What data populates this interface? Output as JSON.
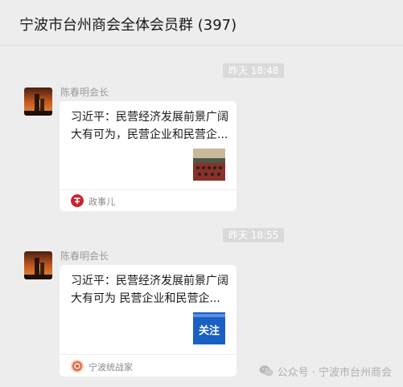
{
  "window": {
    "title": "宁波市台州商会全体会员群 (397)"
  },
  "messages": [
    {
      "time": "昨天 18:48",
      "sender": "陈春明会长",
      "card": {
        "title": "习近平：民营经济发展前景广阔大有可为，民营企业和民营企...",
        "source": "政事儿",
        "thumbnail_icon": "meeting-photo-thumbnail"
      }
    },
    {
      "time": "昨天 18:55",
      "sender": "陈春明会长",
      "card": {
        "title": "习近平：民营经济发展前景广阔大有可为 民营企业和民营企...",
        "source": "宁波统战家",
        "thumb_text": "关注",
        "thumbnail_icon": "follow-badge-thumbnail"
      }
    }
  ],
  "watermark": {
    "text": "公众号 · 宁波市台州商会"
  },
  "colors": {
    "background": "#ededed",
    "card": "#ffffff",
    "thumb_blue": "#1a5fc4"
  }
}
